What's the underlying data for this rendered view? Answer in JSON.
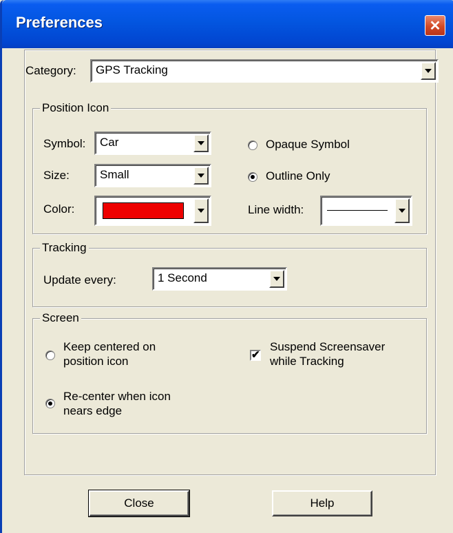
{
  "window": {
    "title": "Preferences",
    "close_glyph": "✕"
  },
  "category": {
    "label": "Category:",
    "value": "GPS Tracking"
  },
  "position_icon": {
    "legend": "Position Icon",
    "symbol_label": "Symbol:",
    "symbol_value": "Car",
    "size_label": "Size:",
    "size_value": "Small",
    "color_label": "Color:",
    "color_value": "#ee0000",
    "opaque_label": "Opaque Symbol",
    "opaque_selected": false,
    "outline_label": "Outline Only",
    "outline_selected": true,
    "line_width_label": "Line width:"
  },
  "tracking": {
    "legend": "Tracking",
    "update_label": "Update every:",
    "update_value": "1 Second"
  },
  "screen": {
    "legend": "Screen",
    "keep_centered_line1": "Keep centered on",
    "keep_centered_line2": "position icon",
    "recenter_line1": "Re-center when icon",
    "recenter_line2": "nears edge",
    "suspend_line1": "Suspend Screensaver",
    "suspend_line2": "while Tracking",
    "check_glyph": "✔"
  },
  "buttons": {
    "close": "Close",
    "help": "Help"
  }
}
